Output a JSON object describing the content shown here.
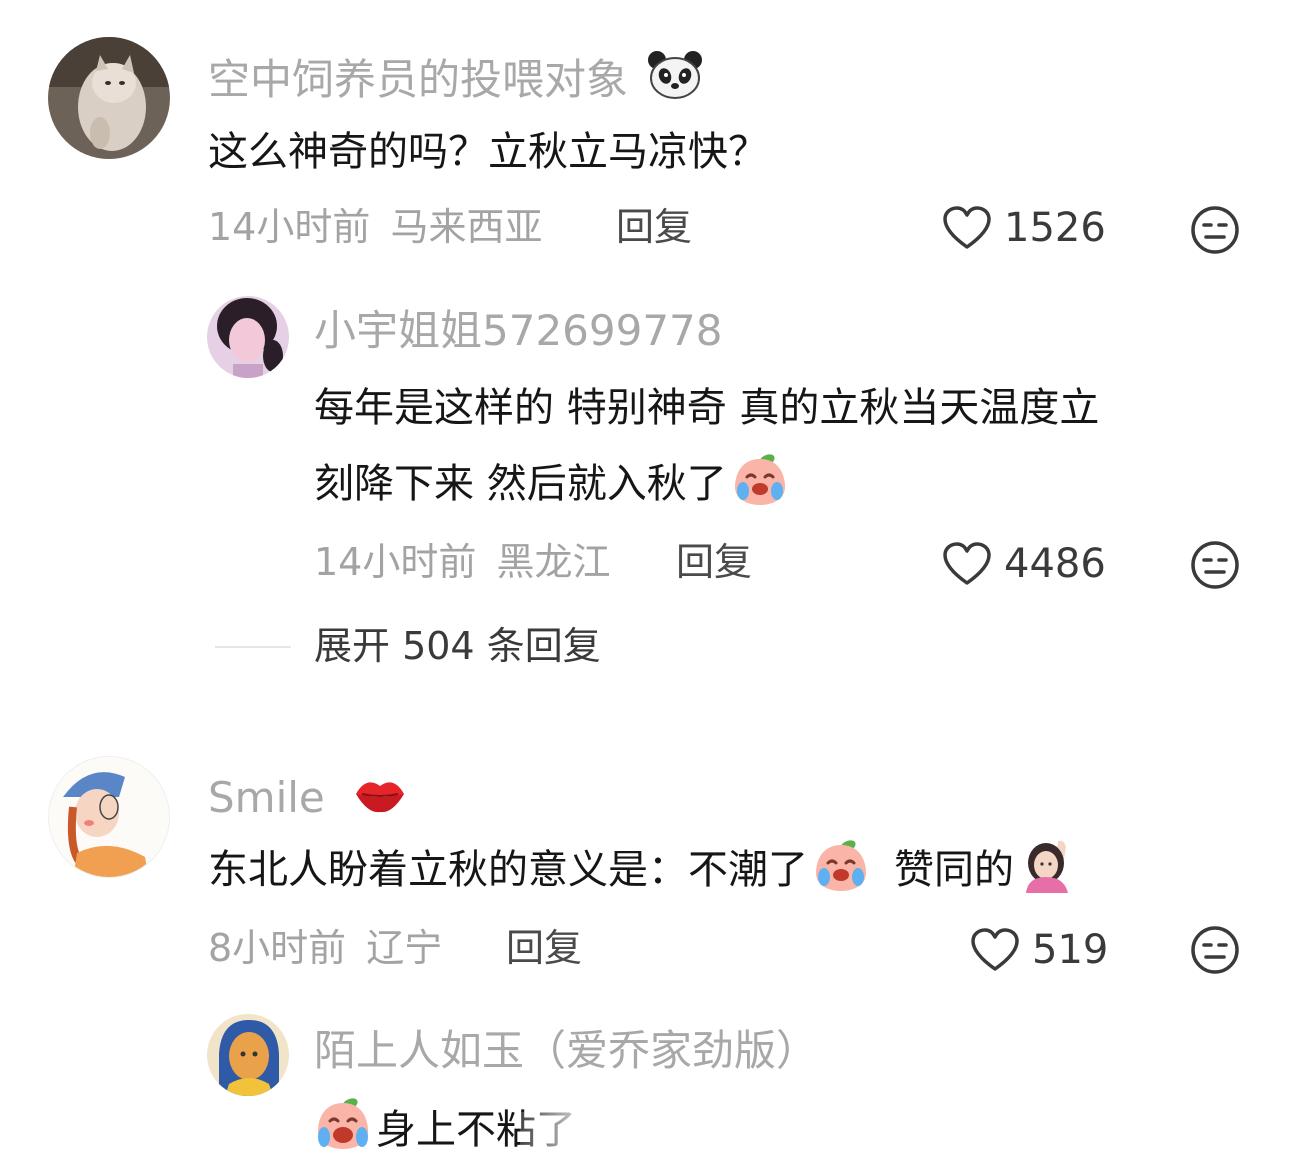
{
  "comments": [
    {
      "username": "空中饲养员的投喂对象",
      "username_emoji": "panda-face-icon",
      "text": "这么神奇的吗？立秋立马凉快？",
      "time": "14小时前",
      "location": "马来西亚",
      "reply_label": "回复",
      "likes": "1526",
      "replies": [
        {
          "username": "小宇姐姐572699778",
          "text_line1": "每年是这样的 特别神奇 真的立秋当天温度立",
          "text_line2": "刻降下来 然后就入秋了",
          "text_emoji": "crying-peach-icon",
          "time": "14小时前",
          "location": "黑龙江",
          "reply_label": "回复",
          "likes": "4486"
        }
      ],
      "expand_label": "展开 504 条回复"
    },
    {
      "username": "Smile",
      "username_emoji": "kiss-lips-icon",
      "text_part1": "东北人盼着立秋的意义是：不潮了",
      "text_part2": "赞同的",
      "time": "8小时前",
      "location": "辽宁",
      "reply_label": "回复",
      "likes": "519",
      "replies": [
        {
          "username": "陌上人如玉（爱乔家劲版）",
          "text": "身上不粘了"
        }
      ]
    }
  ]
}
